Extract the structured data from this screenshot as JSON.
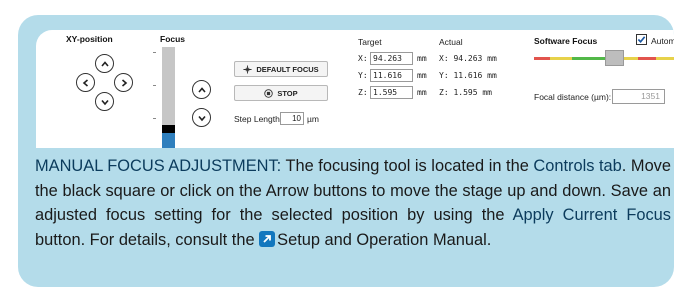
{
  "xy": {
    "title": "XY-position"
  },
  "focus": {
    "title": "Focus"
  },
  "buttons": {
    "default_focus": "DEFAULT FOCUS",
    "stop": "STOP"
  },
  "step": {
    "label": "Step Length:",
    "value": "10",
    "unit": "µm"
  },
  "target": {
    "title": "Target",
    "x_label": "X:",
    "x": "94.263",
    "y_label": "Y:",
    "y": "11.616",
    "z_label": "Z:",
    "z": "1.595",
    "unit": "mm"
  },
  "actual": {
    "title": "Actual",
    "x": "X: 94.263 mm",
    "y": "Y: 11.616 mm",
    "z": "Z: 1.595 mm"
  },
  "software_focus": {
    "title": "Software Focus",
    "automatic_label": "Automatic",
    "automatic_checked": true,
    "focal_label": "Focal distance (µm):",
    "focal_value": "1351"
  },
  "description": {
    "p1": "MANUAL FOCUS ADJUSTMENT:",
    "p2": " The focusing tool is located in the ",
    "p3": "Controls tab",
    "p4": ". Move the black square or click on the Arrow buttons to move the stage up and down. Save an adjusted focus setting for the selected position by using the ",
    "p5": "Apply Current Focus",
    "p6": " button. For details, consult the ",
    "p7": "Setup and Operation Manual",
    "p8": "."
  },
  "icons": [
    "chevron-up-icon",
    "chevron-down-icon",
    "chevron-left-icon",
    "chevron-right-icon",
    "crosshair-icon",
    "stop-icon",
    "checkbox-check-icon",
    "external-link-icon"
  ],
  "colors": {
    "panel": "#b4dcea",
    "focus_fill": "#2f7fbd",
    "link_icon": "#1277be"
  }
}
